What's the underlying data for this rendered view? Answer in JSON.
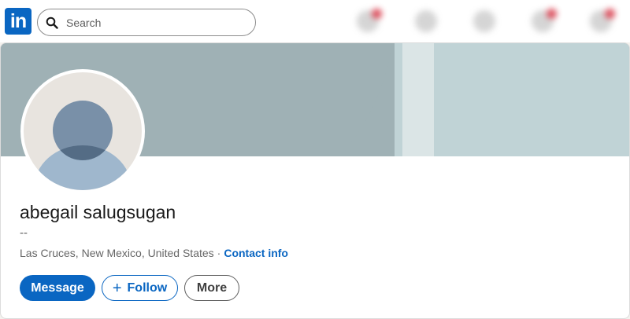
{
  "topbar": {
    "logo_text": "in",
    "search": {
      "placeholder": "Search"
    },
    "nav_icons": [
      "home-icon",
      "network-icon",
      "jobs-icon",
      "messaging-icon",
      "notifications-icon"
    ]
  },
  "profile": {
    "name": "abegail salugsugan",
    "headline": "--",
    "location": "Las Cruces, New Mexico, United States",
    "separator": "·",
    "contact_label": "Contact info"
  },
  "actions": {
    "message_label": "Message",
    "follow_icon": "+",
    "follow_label": "Follow",
    "more_label": "More"
  },
  "colors": {
    "accent": "#0a66c2",
    "banner": "#9fb1b5",
    "banner_light": "#c0d3d6"
  }
}
